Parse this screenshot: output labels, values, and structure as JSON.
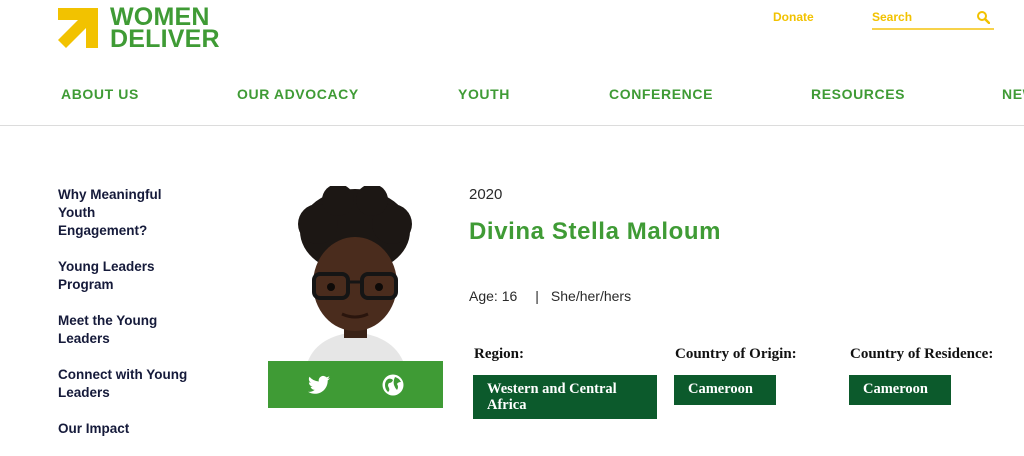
{
  "brand": {
    "line1": "WOMEN",
    "line2": "DELIVER",
    "green": "#3f9b35",
    "yellow": "#f2c200"
  },
  "header": {
    "donate_label": "Donate",
    "search_placeholder": "Search",
    "search_icon": "magnifier-icon"
  },
  "nav": {
    "items": [
      "ABOUT US",
      "OUR ADVOCACY",
      "YOUTH",
      "CONFERENCE",
      "RESOURCES",
      "NEWS"
    ]
  },
  "sidebar": {
    "items": [
      "Why Meaningful Youth Engagement?",
      "Young Leaders Program",
      "Meet the Young Leaders",
      "Connect with Young Leaders",
      "Our Impact"
    ]
  },
  "profile": {
    "year": "2020",
    "name": "Divina Stella Maloum",
    "age": "Age: 16",
    "separator": "|",
    "pronouns": "She/her/hers",
    "social_icons": [
      "twitter-icon",
      "globe-icon"
    ],
    "region_label": "Region:",
    "region_value": "Western and Central Africa",
    "origin_label": "Country of Origin:",
    "origin_value": "Cameroon",
    "residence_label": "Country of Residence:",
    "residence_value": "Cameroon",
    "tag_color": "#0c5a2c"
  }
}
